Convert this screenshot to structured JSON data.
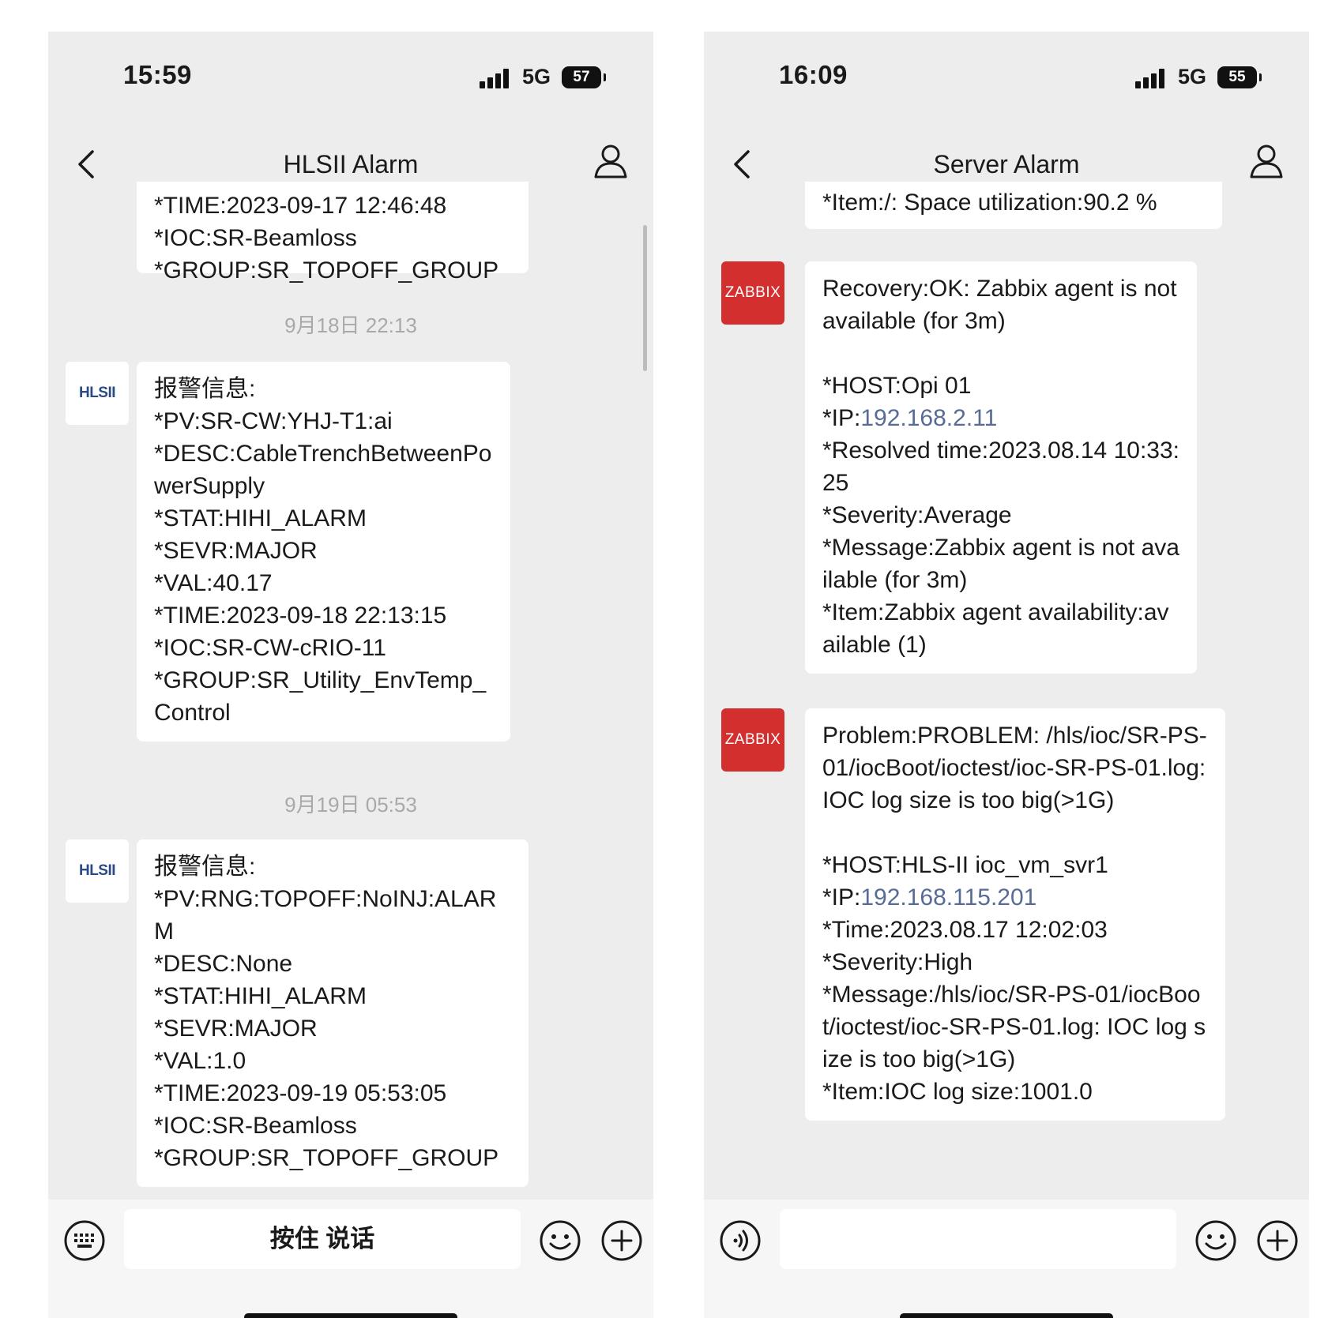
{
  "left_phone": {
    "status": {
      "time": "15:59",
      "network": "5G",
      "battery": "57"
    },
    "nav": {
      "title": "HLSII Alarm"
    },
    "partial_message": "*TIME:2023-09-17 12:46:48\n*IOC:SR-Beamloss\n*GROUP:SR_TOPOFF_GROUP",
    "timestamps": [
      "9月18日 22:13",
      "9月19日 05:53"
    ],
    "avatar_label": "HLSII",
    "messages": [
      "报警信息:\n*PV:SR-CW:YHJ-T1:ai\n*DESC:CableTrenchBetweenPowerSupply\n*STAT:HIHI_ALARM\n*SEVR:MAJOR\n*VAL:40.17\n*TIME:2023-09-18 22:13:15\n*IOC:SR-CW-cRIO-11\n*GROUP:SR_Utility_EnvTemp_Control",
      "报警信息:\n*PV:RNG:TOPOFF:NoINJ:ALARM\n*DESC:None\n*STAT:HIHI_ALARM\n*SEVR:MAJOR\n*VAL:1.0\n*TIME:2023-09-19 05:53:05\n*IOC:SR-Beamloss\n*GROUP:SR_TOPOFF_GROUP"
    ],
    "input": {
      "voice_label": "按住 说话"
    }
  },
  "right_phone": {
    "status": {
      "time": "16:09",
      "network": "5G",
      "battery": "55"
    },
    "nav": {
      "title": "Server Alarm"
    },
    "partial_message": "*Item:/: Space utilization:90.2 %",
    "avatar_label": "ZABBIX",
    "message1": {
      "line1": "Recovery:OK: Zabbix agent is not available (for 3m)\n\n*HOST:Opi 01\n*IP:",
      "ip": "192.168.2.11",
      "line2": "\n*Resolved time:2023.08.14 10:33:25\n*Severity:Average\n*Message:Zabbix agent is not available (for 3m)\n*Item:Zabbix agent availability:available (1)"
    },
    "message2": {
      "line1": "Problem:PROBLEM: /hls/ioc/SR-PS-01/iocBoot/ioctest/ioc-SR-PS-01.log: IOC log size is too big(>1G)\n\n*HOST:HLS-II ioc_vm_svr1\n*IP:",
      "ip": "192.168.115.201",
      "line2": "\n*Time:2023.08.17 12:02:03\n*Severity:High\n*Message:/hls/ioc/SR-PS-01/iocBoot/ioctest/ioc-SR-PS-01.log: IOC log size is too big(>1G)\n*Item:IOC log size:1001.0"
    }
  },
  "colors": {
    "background": "#ededed",
    "bubble": "#ffffff",
    "link": "#576b95",
    "zabbix": "#d32f2f",
    "hlsii_text": "#2b4a86"
  },
  "icons": [
    "back-chevron-icon",
    "user-icon",
    "keyboard-icon",
    "voice-icon",
    "emoji-icon",
    "plus-icon",
    "signal-icon",
    "battery-icon"
  ]
}
